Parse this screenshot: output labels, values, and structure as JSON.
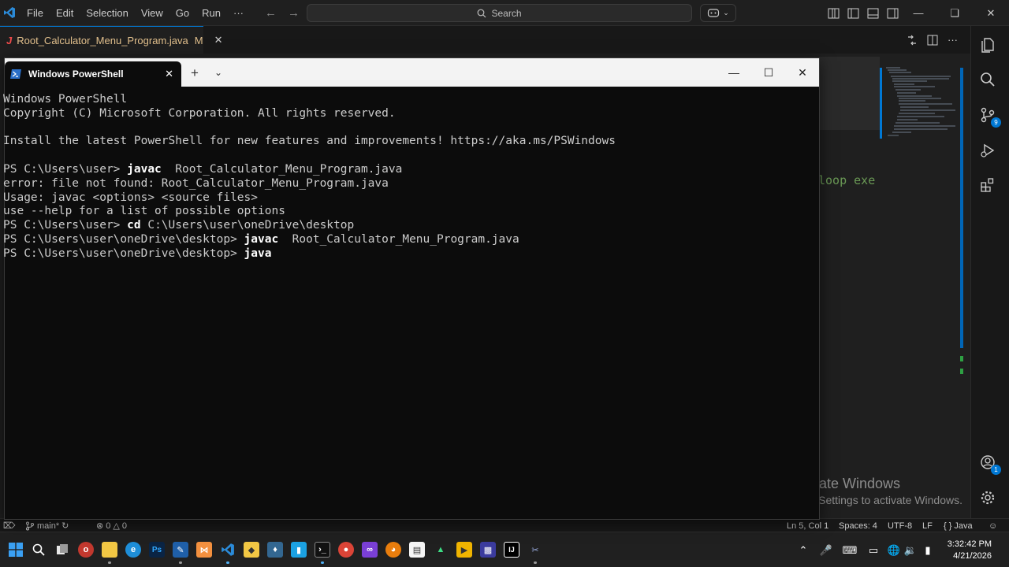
{
  "vscode": {
    "menu": [
      "File",
      "Edit",
      "Selection",
      "View",
      "Go",
      "Run",
      "···"
    ],
    "search_label": "Search",
    "tab": {
      "prefix": "J",
      "filename": "Root_Calculator_Menu_Program.java",
      "status": "M"
    },
    "code_fragment": "loop exe",
    "activity_badges": {
      "source_control": "9",
      "accounts": "1"
    },
    "status_bar": {
      "branch": "main*",
      "errors": "0",
      "warnings": "0",
      "position": "Ln 5, Col 1",
      "spaces": "Spaces: 4",
      "encoding": "UTF-8",
      "eol": "LF",
      "language": "Java"
    }
  },
  "powershell": {
    "tab_title": "Windows PowerShell",
    "lines": [
      {
        "prompt": "",
        "cmd": "",
        "rest": "Windows PowerShell"
      },
      {
        "prompt": "",
        "cmd": "",
        "rest": "Copyright (C) Microsoft Corporation. All rights reserved."
      },
      {
        "prompt": "",
        "cmd": "",
        "rest": ""
      },
      {
        "prompt": "",
        "cmd": "",
        "rest": "Install the latest PowerShell for new features and improvements! https://aka.ms/PSWindows"
      },
      {
        "prompt": "",
        "cmd": "",
        "rest": ""
      },
      {
        "prompt": "PS C:\\Users\\user> ",
        "cmd": "javac",
        "rest": "  Root_Calculator_Menu_Program.java"
      },
      {
        "prompt": "",
        "cmd": "",
        "rest": "error: file not found: Root_Calculator_Menu_Program.java"
      },
      {
        "prompt": "",
        "cmd": "",
        "rest": "Usage: javac <options> <source files>"
      },
      {
        "prompt": "",
        "cmd": "",
        "rest": "use --help for a list of possible options"
      },
      {
        "prompt": "PS C:\\Users\\user> ",
        "cmd": "cd",
        "rest": " C:\\Users\\user\\oneDrive\\desktop"
      },
      {
        "prompt": "PS C:\\Users\\user\\oneDrive\\desktop> ",
        "cmd": "javac",
        "rest": "  Root_Calculator_Menu_Program.java"
      },
      {
        "prompt": "PS C:\\Users\\user\\oneDrive\\desktop> ",
        "cmd": "java",
        "rest": ""
      }
    ]
  },
  "watermark": {
    "title": "Activate Windows",
    "subtitle": "Go to Settings to activate Windows."
  },
  "taskbar": {
    "time": "3:32:42 PM",
    "date": "4/21/2026"
  }
}
